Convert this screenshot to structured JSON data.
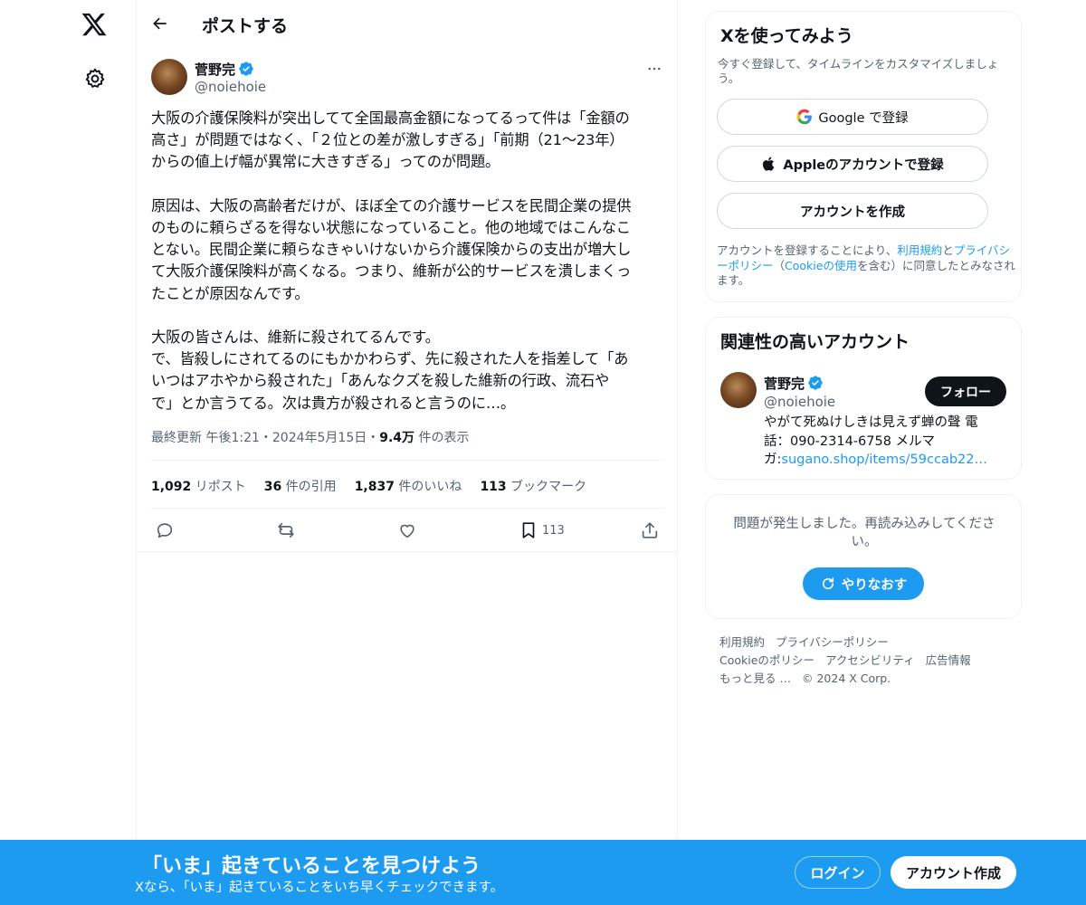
{
  "nav": {
    "logo_icon": "x-logo-icon",
    "settings_icon": "gear-icon"
  },
  "header": {
    "title": "ポストする"
  },
  "tweet": {
    "author_name": "菅野完",
    "author_handle": "@noiehoie",
    "body": "大阪の介護保険料が突出してて全国最高金額になってるって件は「金額の\n高さ」が問題ではなく、「２位との差が激しすぎる」「前期（21〜23年）\nからの値上げ幅が異常に大きすぎる」ってのが問題。\n\n原因は、大阪の高齢者だけが、ほぼ全ての介護サービスを民間企業の提供\nのものに頼らざるを得ない状態になっていること。他の地域ではこんなこ\nとない。民間企業に頼らなきゃいけないから介護保険からの支出が増大し\nて大阪介護保険料が高くなる。つまり、維新が公的サービスを潰しまくっ\nたことが原因なんです。\n\n大阪の皆さんは、維新に殺されてるんです。\nで、皆殺しにされてるのにもかかわらず、先に殺された人を指差して「あ\nいつはアホやから殺された」「あんなクズを殺した維新の行政、流石や\nで」とか言うてる。次は貴方が殺されると言うのに…。",
    "meta_prefix": "最終更新 午後1:21・2024年5月15日・",
    "views_count": "9.4万",
    "views_label": " 件の表示",
    "stats": {
      "reposts_count": "1,092",
      "reposts_label": " リポスト",
      "quotes_count": "36",
      "quotes_label": " 件の引用",
      "likes_count": "1,837",
      "likes_label": " 件のいいね",
      "bookmarks_count": "113",
      "bookmarks_label": " ブックマーク"
    },
    "actions": {
      "bookmark_count": "113"
    }
  },
  "signup_card": {
    "title": "Xを使ってみよう",
    "subtitle": "今すぐ登録して、タイムラインをカスタマイズしましょう。",
    "google_label": "Google で登録",
    "apple_label": "Appleのアカウントで登録",
    "create_label": "アカウントを作成",
    "legal_1": "アカウントを登録することにより、",
    "legal_terms": "利用規約",
    "legal_2": "と",
    "legal_privacy": "プライバシーポリシー",
    "legal_3": "（",
    "legal_cookie": "Cookieの使用",
    "legal_4": "を含む）に同意したとみなされます。"
  },
  "related_card": {
    "title": "関連性の高いアカウント",
    "name": "菅野完",
    "handle": "@noiehoie",
    "follow_label": "フォロー",
    "bio_text": "やがて死ぬけしきは見えず蝉の聲 電話：090-2314-6758 メルマガ:",
    "bio_link": "sugano.shop/items/59ccab22…"
  },
  "error_card": {
    "message": "問題が発生しました。再読み込みしてください。",
    "retry_label": "やりなおす"
  },
  "footer": {
    "links": [
      "利用規約",
      "プライバシーポリシー",
      "Cookieのポリシー",
      "アクセシビリティ",
      "広告情報",
      "もっと見る …"
    ],
    "copyright": "© 2024 X Corp."
  },
  "banner": {
    "title": "「いま」起きていることを見つけよう",
    "subtitle": "Xなら、「いま」起きていることをいち早くチェックできます。",
    "login_label": "ログイン",
    "signup_label": "アカウント作成"
  },
  "colors": {
    "accent": "#1d9bf0",
    "text": "#0f1419",
    "secondary": "#536471",
    "border": "#eff3f4"
  }
}
